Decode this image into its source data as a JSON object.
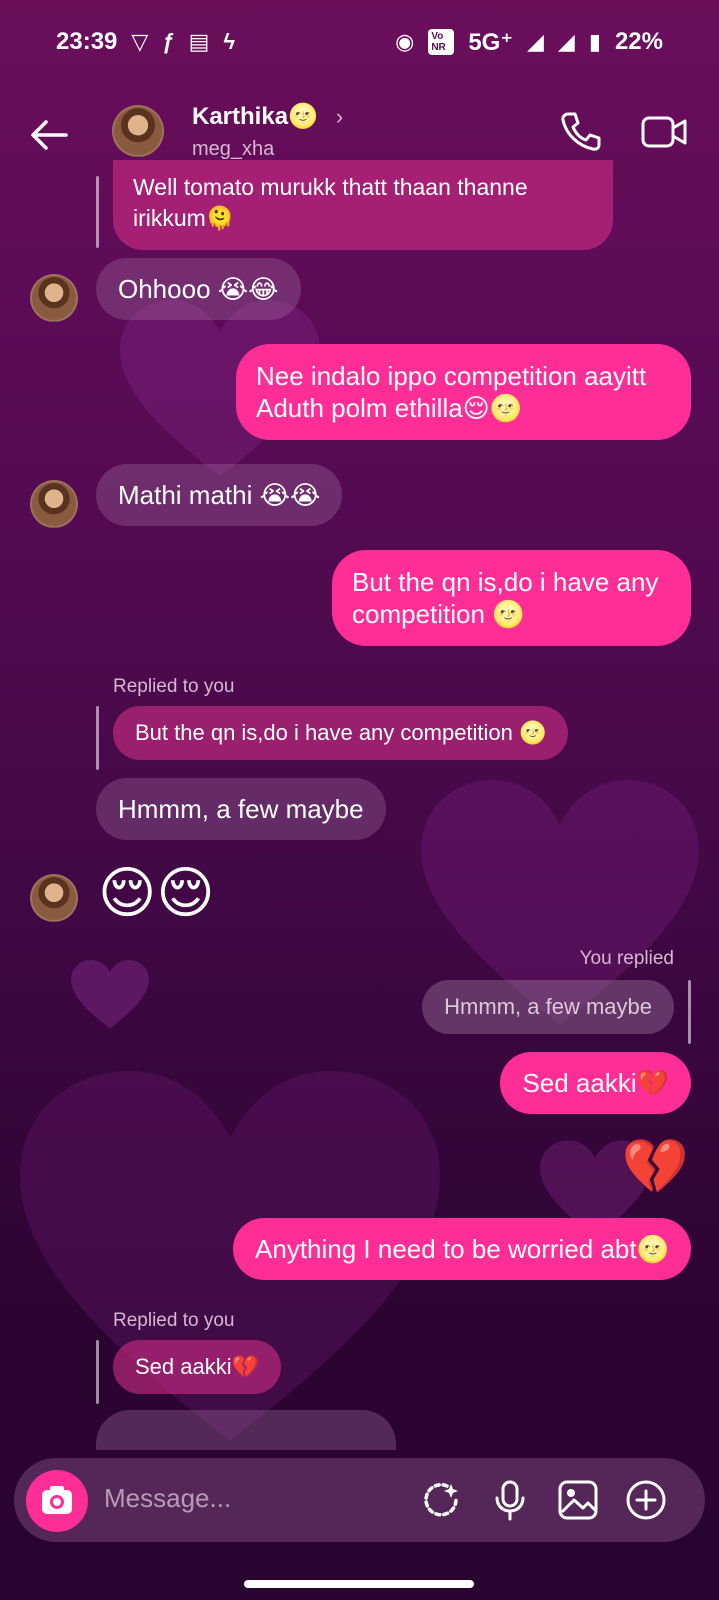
{
  "status_bar": {
    "time": "23:39",
    "network": "5G⁺",
    "battery": "22%",
    "volte": "Vo NR"
  },
  "header": {
    "contact_name": "Karthika🌝",
    "username": "meg_xha"
  },
  "messages": {
    "m1": "Well tomato murukk thatt thaan thanne irikkum🫠",
    "m2": "Ohhooo 😭😂",
    "m3_line1": "Nee indalo ippo competition aayitt",
    "m3_line2": "Aduth polm ethilla😌🌝",
    "m4": "Mathi mathi 😭😭",
    "m5_line1": "But the qn is,do i have any",
    "m5_line2": "competition 🌝",
    "replied_to_you_1": "Replied to you",
    "quote_1": "But the qn is,do i have any competition 🌝",
    "m6": "Hmmm, a few maybe",
    "m7": "😌😌",
    "you_replied": "You replied",
    "quote_2": "Hmmm, a few maybe",
    "m8": "Sed aakki💔",
    "m9": "💔",
    "m10": "Anything I need to be worried abt🌝",
    "replied_to_you_2": "Replied to you",
    "quote_3": "Sed aakki💔"
  },
  "composer": {
    "placeholder": "Message..."
  },
  "icons": [
    "back-arrow-icon",
    "chevron-right-icon",
    "phone-icon",
    "video-camera-icon",
    "camera-icon",
    "sticker-sparkle-icon",
    "microphone-icon",
    "gallery-icon",
    "plus-circle-icon"
  ],
  "colors": {
    "outgoing_bubble": "#ff2d96",
    "background_top": "#6a0e5a",
    "background_bottom": "#2a0430"
  }
}
